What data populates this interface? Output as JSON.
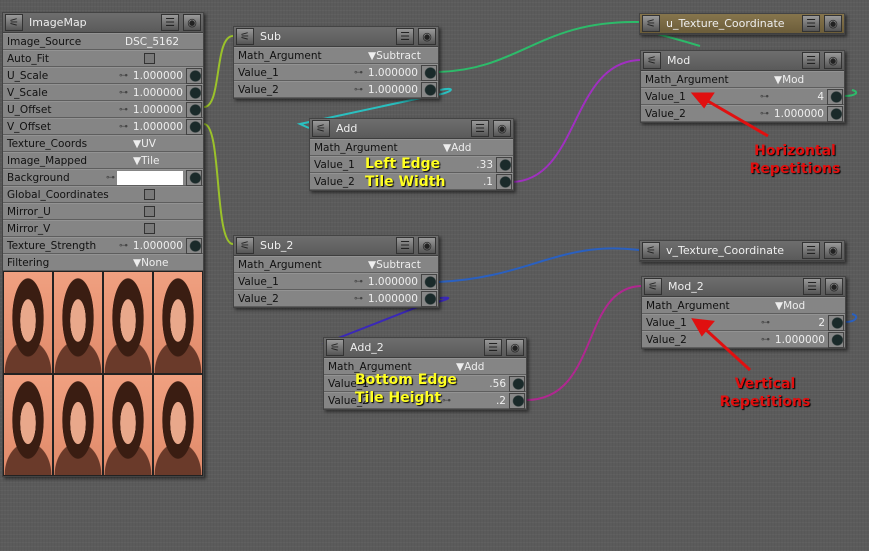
{
  "nodes": [
    {
      "id": "imagemap",
      "title": "ImageMap",
      "rows": [
        {
          "label": "Image_Source",
          "value": "DSC_5162",
          "kind": "text"
        },
        {
          "label": "Auto_Fit",
          "kind": "check"
        },
        {
          "label": "U_Scale",
          "value": "1.000000",
          "kind": "num"
        },
        {
          "label": "V_Scale",
          "value": "1.000000",
          "kind": "num"
        },
        {
          "label": "U_Offset",
          "value": "1.000000",
          "kind": "num"
        },
        {
          "label": "V_Offset",
          "value": "1.000000",
          "kind": "num"
        },
        {
          "label": "Texture_Coords",
          "value": "UV",
          "kind": "sel"
        },
        {
          "label": "Image_Mapped",
          "value": "Tile",
          "kind": "sel"
        },
        {
          "label": "Background",
          "kind": "color"
        },
        {
          "label": "Global_Coordinates",
          "kind": "check"
        },
        {
          "label": "Mirror_U",
          "kind": "check"
        },
        {
          "label": "Mirror_V",
          "kind": "check"
        },
        {
          "label": "Texture_Strength",
          "value": "1.000000",
          "kind": "num"
        },
        {
          "label": "Filtering",
          "value": "None",
          "kind": "sel"
        }
      ],
      "image": true
    },
    {
      "id": "sub",
      "title": "Sub",
      "rows": [
        {
          "label": "Math_Argument",
          "value": "Subtract",
          "kind": "sel"
        },
        {
          "label": "Value_1",
          "value": "1.000000",
          "kind": "num"
        },
        {
          "label": "Value_2",
          "value": "1.000000",
          "kind": "num"
        }
      ]
    },
    {
      "id": "add",
      "title": "Add",
      "rows": [
        {
          "label": "Math_Argument",
          "value": "Add",
          "kind": "sel"
        },
        {
          "label": "Value_1",
          "value": ".33",
          "kind": "num"
        },
        {
          "label": "Value_2",
          "value": ".1",
          "kind": "num"
        }
      ]
    },
    {
      "id": "u-texture-coordinate",
      "title": "u_Texture_Coordinate",
      "brown": true,
      "rows": []
    },
    {
      "id": "mod",
      "title": "Mod",
      "rows": [
        {
          "label": "Math_Argument",
          "value": "Mod",
          "kind": "sel"
        },
        {
          "label": "Value_1",
          "value": "4",
          "kind": "num"
        },
        {
          "label": "Value_2",
          "value": "1.000000",
          "kind": "num"
        }
      ]
    },
    {
      "id": "sub-2",
      "title": "Sub_2",
      "rows": [
        {
          "label": "Math_Argument",
          "value": "Subtract",
          "kind": "sel"
        },
        {
          "label": "Value_1",
          "value": "1.000000",
          "kind": "num"
        },
        {
          "label": "Value_2",
          "value": "1.000000",
          "kind": "num"
        }
      ]
    },
    {
      "id": "add-2",
      "title": "Add_2",
      "rows": [
        {
          "label": "Math_Argument",
          "value": "Add",
          "kind": "sel"
        },
        {
          "label": "Value_1",
          "value": ".56",
          "kind": "num"
        },
        {
          "label": "Value_2",
          "value": ".2",
          "kind": "num"
        }
      ]
    },
    {
      "id": "v-texture-coordinate",
      "title": "v_Texture_Coordinate",
      "rows": []
    },
    {
      "id": "mod-2",
      "title": "Mod_2",
      "rows": [
        {
          "label": "Math_Argument",
          "value": "Mod",
          "kind": "sel"
        },
        {
          "label": "Value_1",
          "value": "2",
          "kind": "num"
        },
        {
          "label": "Value_2",
          "value": "1.000000",
          "kind": "num"
        }
      ]
    }
  ],
  "annotations": {
    "left_edge": "Left Edge",
    "tile_width": "Tile Width",
    "bottom_edge": "Bottom Edge",
    "tile_height": "Tile Height",
    "horizontal": "Horizontal",
    "horizontal_2": "Repetitions",
    "vertical": "Vertical",
    "vertical_2": "Repetitions"
  },
  "colors": {
    "annotation_yellow": "#ffff22",
    "annotation_red": "#e01010"
  }
}
